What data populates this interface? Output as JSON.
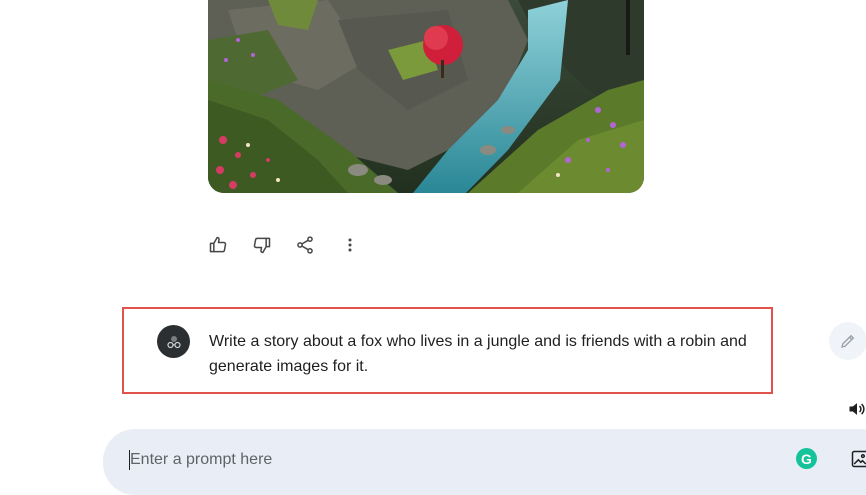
{
  "response": {
    "image_alt": "AI-generated illustration of a river running through a rocky canyon with flowering meadows and a red tree",
    "actions": [
      {
        "name": "thumbs-up",
        "icon": "thumb-up-icon"
      },
      {
        "name": "thumbs-down",
        "icon": "thumb-down-icon"
      },
      {
        "name": "share",
        "icon": "share-icon"
      },
      {
        "name": "more",
        "icon": "more-vert-icon"
      }
    ]
  },
  "user_prompt": {
    "text": "Write a story about a fox who lives in a jungle and is friends with a robin and generate images for it.",
    "highlight_color": "#e0524b"
  },
  "input": {
    "placeholder": "Enter a prompt here",
    "value": ""
  },
  "colors": {
    "input_bg": "#e9eef6",
    "grammarly": "#15c39a",
    "avatar_bg": "#2b2f31"
  },
  "icons": {
    "edit": "pencil-icon",
    "speaker": "volume-icon",
    "grammarly": "grammarly-icon",
    "image_upload": "image-upload-icon"
  },
  "grammarly_letter": "G"
}
